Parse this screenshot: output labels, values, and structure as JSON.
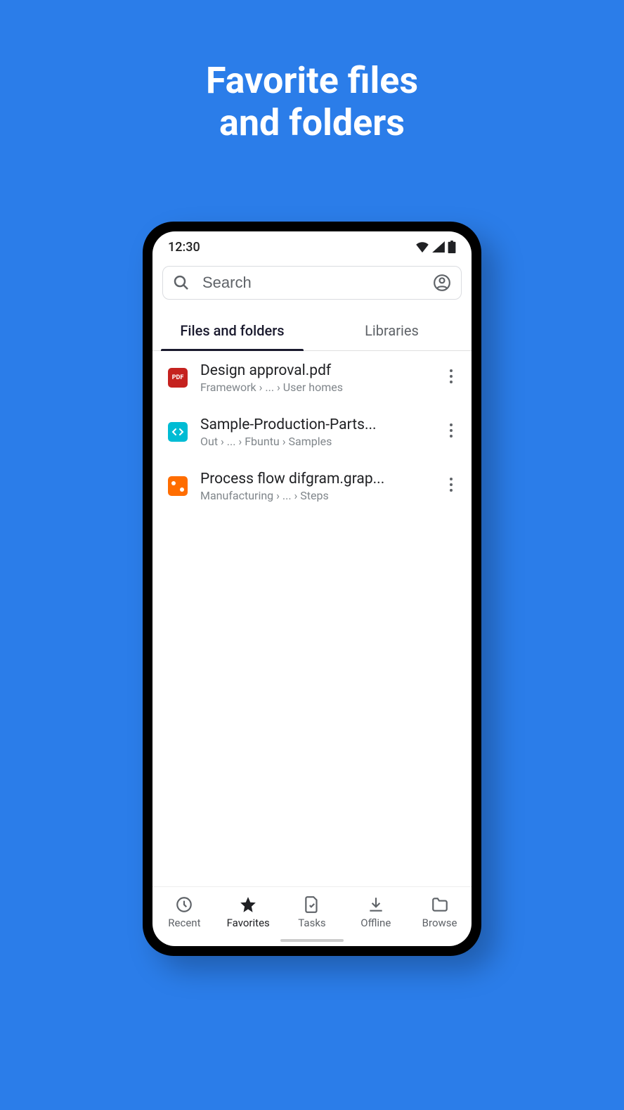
{
  "headline": "Favorite files\nand folders",
  "status": {
    "time": "12:30"
  },
  "search": {
    "placeholder": "Search"
  },
  "tabs": [
    {
      "label": "Files and folders",
      "active": true
    },
    {
      "label": "Libraries",
      "active": false
    }
  ],
  "files": [
    {
      "name": "Design approval.pdf",
      "path": "Framework › ... › User homes",
      "iconType": "pdf"
    },
    {
      "name": "Sample-Production-Parts...",
      "path": "Out › ... › Fbuntu › Samples",
      "iconType": "code"
    },
    {
      "name": "Process flow difgram.grap...",
      "path": "Manufacturing › ... › Steps",
      "iconType": "graph"
    }
  ],
  "nav": [
    {
      "label": "Recent",
      "icon": "clock",
      "active": false
    },
    {
      "label": "Favorites",
      "icon": "star",
      "active": true
    },
    {
      "label": "Tasks",
      "icon": "task",
      "active": false
    },
    {
      "label": "Offline",
      "icon": "download",
      "active": false
    },
    {
      "label": "Browse",
      "icon": "folder",
      "active": false
    }
  ]
}
